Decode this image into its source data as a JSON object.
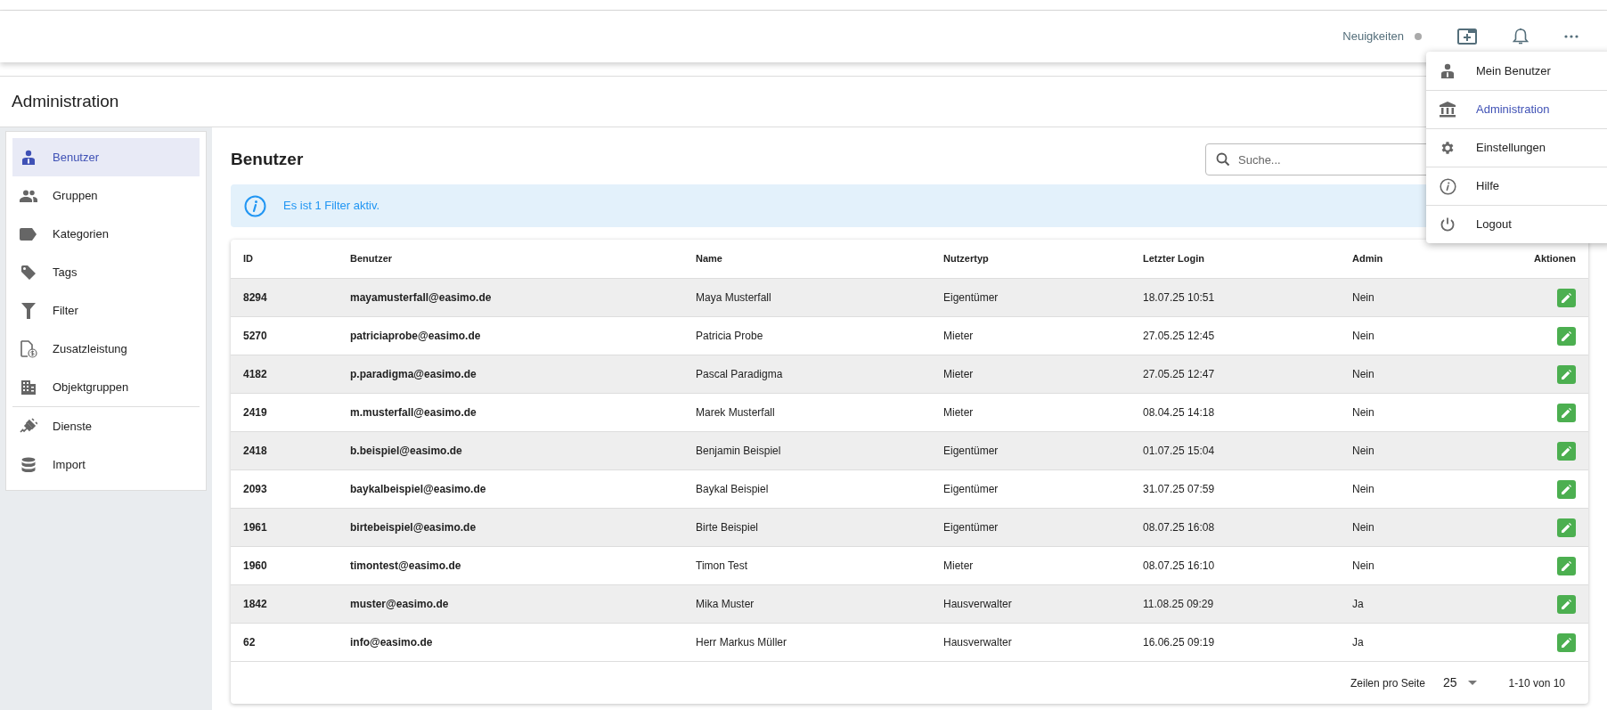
{
  "topbar": {
    "news": {
      "label": "Neuigkeiten",
      "unread": false
    }
  },
  "user_menu": {
    "items": [
      {
        "label": "Mein Benutzer",
        "selected": false
      },
      {
        "label": "Administration",
        "selected": true
      },
      {
        "label": "Einstellungen",
        "selected": false
      },
      {
        "label": "Hilfe",
        "selected": false
      },
      {
        "label": "Logout",
        "selected": false
      }
    ]
  },
  "page_title": "Administration",
  "sidebar": {
    "sections": [
      [
        {
          "label": "Benutzer",
          "selected": true
        },
        {
          "label": "Gruppen",
          "selected": false
        },
        {
          "label": "Kategorien",
          "selected": false
        },
        {
          "label": "Tags",
          "selected": false
        },
        {
          "label": "Filter",
          "selected": false
        },
        {
          "label": "Zusatzleistung",
          "selected": false
        },
        {
          "label": "Objektgruppen",
          "selected": false
        }
      ],
      [
        {
          "label": "Dienste",
          "selected": false
        },
        {
          "label": "Import",
          "selected": false
        }
      ]
    ]
  },
  "content": {
    "title": "Benutzer",
    "search": {
      "placeholder": "Suche..."
    },
    "banner": "Es ist 1 Filter aktiv."
  },
  "table": {
    "columns": [
      "ID",
      "Benutzer",
      "Name",
      "Nutzertyp",
      "Letzter Login",
      "Admin",
      "Aktionen"
    ],
    "rows": [
      [
        "8294",
        "mayamusterfall@easimo.de",
        "Maya Musterfall",
        "Eigentümer",
        "18.07.25 10:51",
        "Nein"
      ],
      [
        "5270",
        "patriciaprobe@easimo.de",
        "Patricia Probe",
        "Mieter",
        "27.05.25 12:45",
        "Nein"
      ],
      [
        "4182",
        "p.paradigma@easimo.de",
        "Pascal Paradigma",
        "Mieter",
        "27.05.25 12:47",
        "Nein"
      ],
      [
        "2419",
        "m.musterfall@easimo.de",
        "Marek Musterfall",
        "Mieter",
        "08.04.25 14:18",
        "Nein"
      ],
      [
        "2418",
        "b.beispiel@easimo.de",
        "Benjamin Beispiel",
        "Eigentümer",
        "01.07.25 15:04",
        "Nein"
      ],
      [
        "2093",
        "baykalbeispiel@easimo.de",
        "Baykal Beispiel",
        "Eigentümer",
        "31.07.25 07:59",
        "Nein"
      ],
      [
        "1961",
        "birtebeispiel@easimo.de",
        "Birte Beispiel",
        "Eigentümer",
        "08.07.25 16:08",
        "Nein"
      ],
      [
        "1960",
        "timontest@easimo.de",
        "Timon Test",
        "Mieter",
        "08.07.25 16:10",
        "Nein"
      ],
      [
        "1842",
        "muster@easimo.de",
        "Mika Muster",
        "Hausverwalter",
        "11.08.25 09:29",
        "Ja"
      ],
      [
        "62",
        "info@easimo.de",
        "Herr Markus Müller",
        "Hausverwalter",
        "16.06.25 09:19",
        "Ja"
      ]
    ],
    "pagination": {
      "rows_label": "Zeilen pro Seite",
      "rows_value": "25",
      "range": "1-10 von 10"
    }
  }
}
